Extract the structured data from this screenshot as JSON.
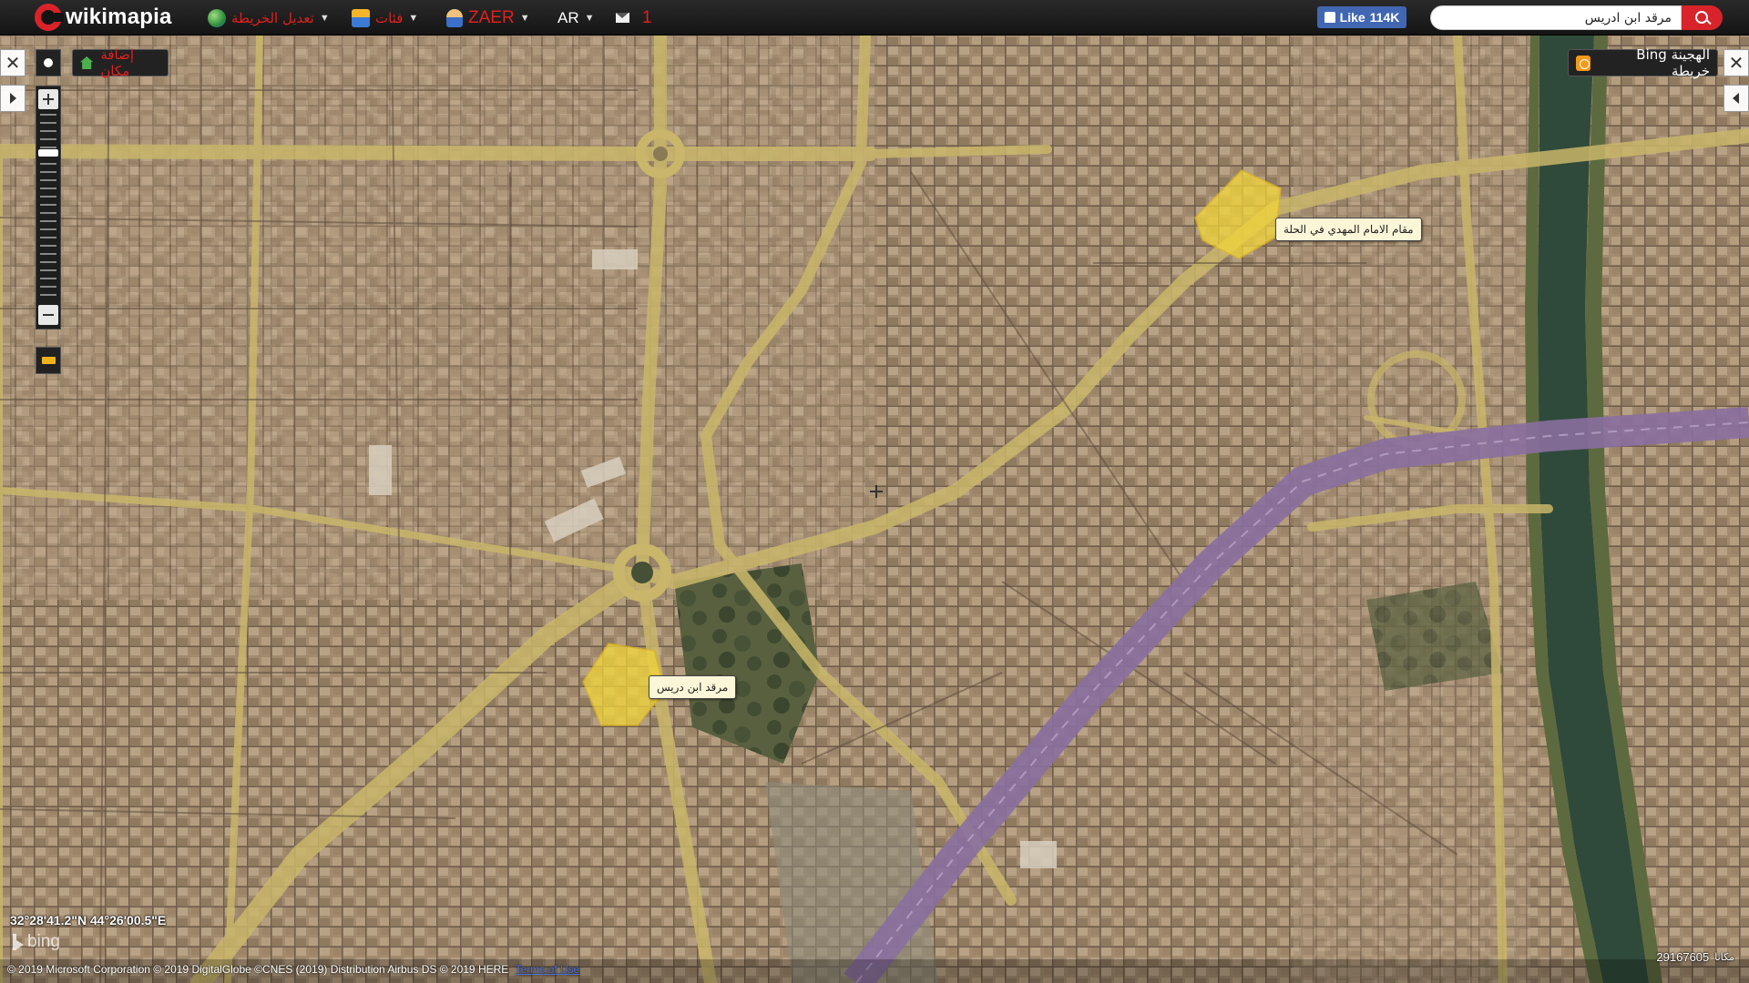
{
  "app": {
    "logo_text": "wikimapia"
  },
  "topbar": {
    "edit_map_label": "تعديل الخريطة",
    "categories_label": "فئات",
    "user_label": "ZAER",
    "language_label": "AR",
    "messages_count": "1",
    "fb_like_label": "Like",
    "fb_like_count": "114K"
  },
  "search": {
    "value": "مرقد ابن ادريس",
    "placeholder": ""
  },
  "map_controls": {
    "add_place_label": "إضافة مكان",
    "layer_label": "الهجينة Bing خريطة",
    "zoom_level_fraction": 0.2
  },
  "places": [
    {
      "name": "مقام الامام المهدي في الحلة"
    },
    {
      "name": "مرقد ابن دريس"
    }
  ],
  "status": {
    "coordinates": "32°28'41.2\"N 44°26'00.5\"E",
    "bing_label": "bing",
    "copyright": "© 2019 Microsoft Corporation © 2019 DigitalGlobe ©CNES (2019) Distribution Airbus DS © 2019 HERE",
    "terms_label": "Terms of Use",
    "place_count": "29167605",
    "place_count_label": "مكانا"
  },
  "colors": {
    "brand_red": "#d9232a",
    "highlight_yellow": "#f2d63a",
    "highway_purple": "#8a6fa0",
    "road_yellow": "#c9b66a",
    "river_green": "#2f4a3a"
  }
}
